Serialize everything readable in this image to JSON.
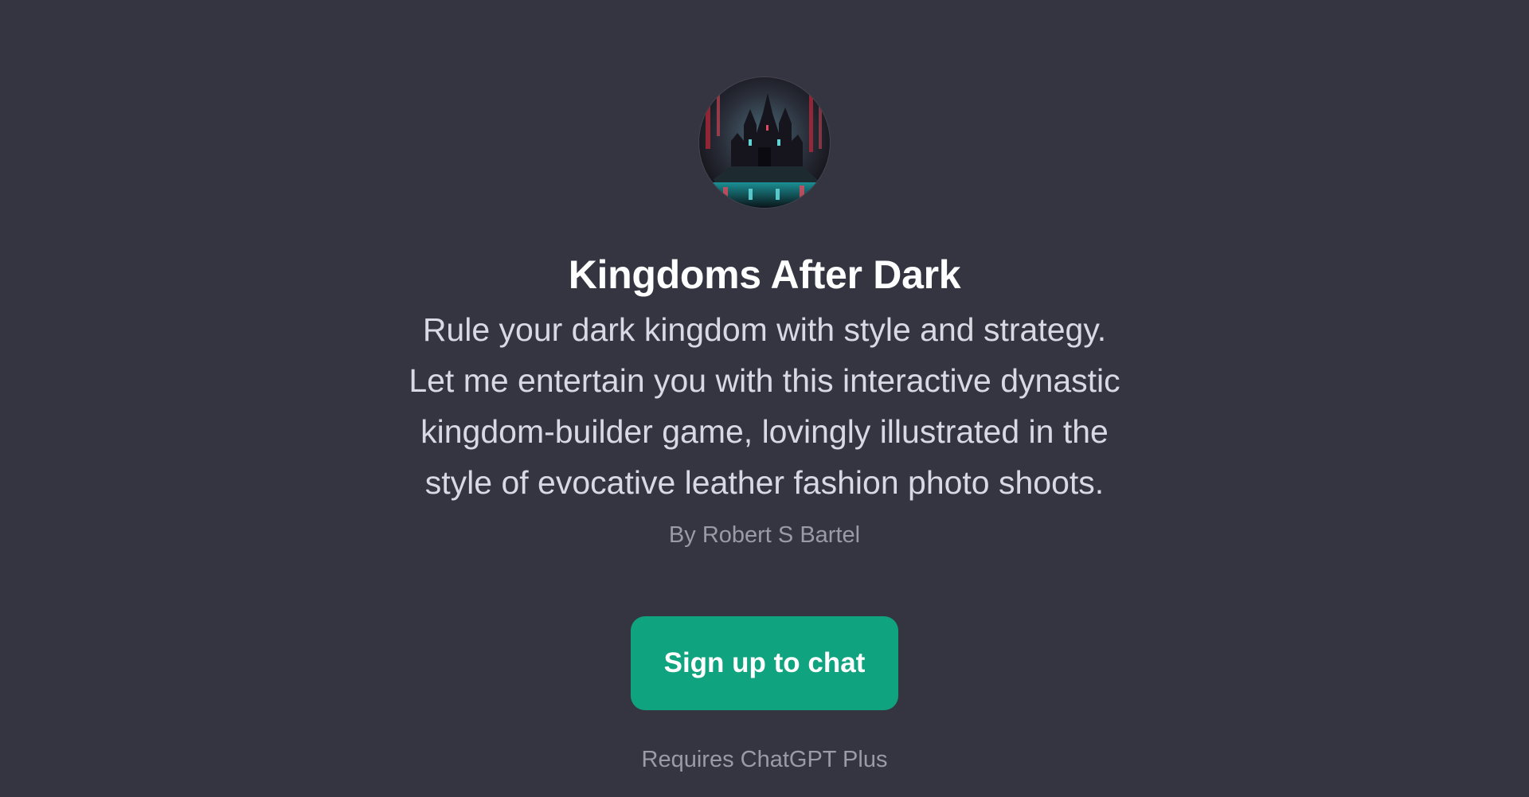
{
  "gpt": {
    "avatar_icon": "dark-castle-avatar-icon",
    "title": "Kingdoms After Dark",
    "description_lines": [
      "Rule your dark kingdom with style and strategy.",
      "Let me entertain you with this interactive dynastic",
      "kingdom-builder game, lovingly illustrated in the",
      "style of evocative leather fashion photo shoots."
    ],
    "author": "By Robert S Bartel"
  },
  "cta": {
    "signup_label": "Sign up to chat",
    "requires_label": "Requires ChatGPT Plus"
  },
  "colors": {
    "background": "#343541",
    "button": "#10a37f",
    "title": "#ffffff",
    "description": "#d9d9e3",
    "muted": "#9a9aa8"
  }
}
